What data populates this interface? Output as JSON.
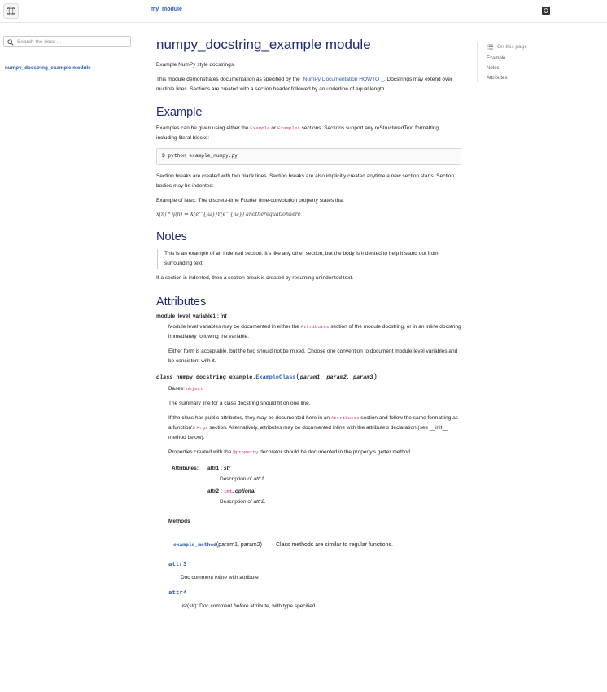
{
  "header": {
    "brand": "my_module"
  },
  "sidebar": {
    "search_placeholder": "Search the docs ...",
    "nav_item": "numpy_docstring_example module"
  },
  "toc": {
    "title": "On this page",
    "items": [
      "Example",
      "Notes",
      "Attributes"
    ]
  },
  "page": {
    "title": "numpy_docstring_example module",
    "intro": "Example NumPy style docstrings.",
    "para1_a": "This module demonstrates documentation as specified by the ",
    "para1_link": "`NumPy Documentation HOWTO`_",
    "para1_b": ". Docstrings may extend over multiple lines. Sections are created with a section header followed by an underline of equal length.",
    "example_heading": "Example",
    "example_p1_a": "Examples can be given using either the ",
    "example_code1": "Example",
    "example_p1_b": " or ",
    "example_code2": "Examples",
    "example_p1_c": " sections. Sections support any reStructuredText formatting, including literal blocks:",
    "code_block": "$ python example_numpy.py",
    "example_p2_a": "Section breaks are created with two blank lines. Section breaks are also implicitly created anytime a new section starts. Section bodies ",
    "example_p2_em": "may",
    "example_p2_b": " be indented:",
    "latex_p": "Example of latex: The discrete-time Fourier time-convolution property states that",
    "math_text": "x(n) * y(n) ⇔ X(e^{jω})Y(e^{jω}) anotherequationhere",
    "notes_heading": "Notes",
    "notes_quote": "This is an example of an indented section. It's like any other section, but the body is indented to help it stand out from surrounding text.",
    "notes_p": "If a section is indented, then a section break is created by resuming unindented text.",
    "attributes_heading": "Attributes",
    "attr_var_name": "module_level_variable1",
    "attr_var_type": "int",
    "attr_var_desc_a": "Module level variables may be documented in either the ",
    "attr_var_desc_code": "Attributes",
    "attr_var_desc_b": " section of the module docstring, or in an inline docstring immediately following the variable.",
    "attr_var_desc2": "Either form is acceptable, but the two should not be mixed. Choose one convention to document module level variables and be consistent with it.",
    "class_keyword": "class",
    "class_module": "numpy_docstring_example.",
    "class_name": "ExampleClass",
    "class_params": "param1, param2, param3",
    "bases_label": "Bases: ",
    "bases_value": "object",
    "class_summary": "The summary line for a class docstring should fit on one line.",
    "class_p2_a": "If the class has public attributes, they may be documented here in an ",
    "class_p2_code": "Attributes",
    "class_p2_b": " section and follow the same formatting as a function's ",
    "class_p2_code2": "Args",
    "class_p2_c": " section. Alternatively, attributes may be documented inline with the attribute's declaration (see __init__ method below).",
    "class_p3_a": "Properties created with the ",
    "class_p3_code": "@property",
    "class_p3_b": " decorator should be documented in the property's getter method.",
    "attributes_label": "Attributes:",
    "attr1_name": "attr1",
    "attr1_type": "str",
    "attr1_desc_a": "Description of ",
    "attr1_desc_em": "attr1",
    "attr2_name": "attr2",
    "attr2_type": "int",
    "attr2_opt": ", optional",
    "attr2_desc_a": "Description of ",
    "attr2_desc_em": "attr2",
    "methods_heading": "Methods",
    "method_name": "example_method",
    "method_args": "(param1, param2)",
    "method_desc": "Class methods are similar to regular functions.",
    "attr3_name": "attr3",
    "attr3_desc_a": "Doc comment ",
    "attr3_desc_em": "inline",
    "attr3_desc_b": " with attribute",
    "attr4_name": "attr4",
    "attr4_desc_a": "list(",
    "attr4_desc_em1": "str",
    "attr4_desc_b": "): Doc comment ",
    "attr4_desc_em2": "before",
    "attr4_desc_c": " attribute, with type specified"
  }
}
